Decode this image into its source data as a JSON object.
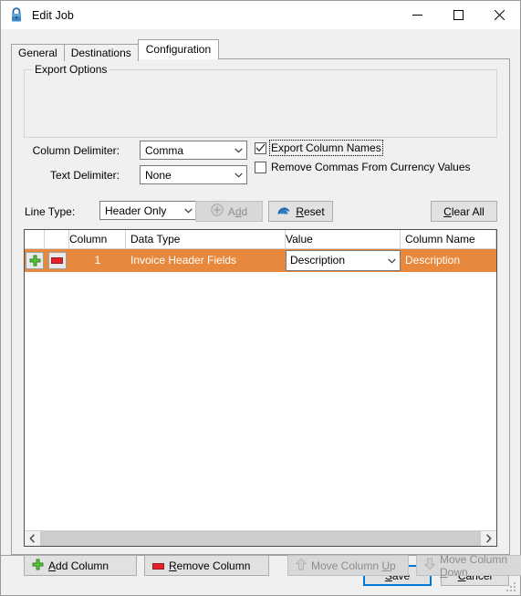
{
  "window": {
    "title": "Edit Job",
    "icon": "lock-icon",
    "controls": {
      "minimize": "—",
      "maximize": "☐",
      "close": "✕"
    }
  },
  "tabs": [
    {
      "label": "General",
      "active": false
    },
    {
      "label": "Destinations",
      "active": false
    },
    {
      "label": "Configuration",
      "active": true
    }
  ],
  "export_options": {
    "group_label": "Export Options",
    "column_delimiter": {
      "label": "Column Delimiter:",
      "value": "Comma"
    },
    "text_delimiter": {
      "label": "Text Delimiter:",
      "value": "None"
    },
    "export_column_names": {
      "label": "Export Column Names",
      "checked": true,
      "focused": true
    },
    "remove_commas": {
      "label": "Remove Commas From Currency Values",
      "checked": false
    }
  },
  "line_type": {
    "label": "Line Type:",
    "value": "Header Only"
  },
  "toolbar": {
    "add": {
      "label": "Add",
      "accel": "d",
      "enabled": false,
      "icon": "plus-circle-icon"
    },
    "reset": {
      "label": "Reset",
      "accel": "R",
      "enabled": true,
      "icon": "reset-arrow-icon"
    },
    "clear_all": {
      "label": "Clear All",
      "accel": "C",
      "enabled": true
    }
  },
  "grid": {
    "columns": [
      "",
      "",
      "Column",
      "Data Type",
      "Value",
      "Column Name"
    ],
    "rows": [
      {
        "selected": true,
        "add_icon": "green-plus-icon",
        "remove_icon": "red-minus-icon",
        "column": "1",
        "data_type": "Invoice Header Fields",
        "value": "Description",
        "column_name": "Description"
      }
    ],
    "scrollbar": {
      "left_arrow": "‹",
      "right_arrow": "›"
    }
  },
  "actions": {
    "add_column": {
      "label": "Add Column",
      "accel": "A",
      "enabled": true,
      "icon": "green-plus-icon"
    },
    "remove_column": {
      "label": "Remove Column",
      "accel": "R",
      "enabled": true,
      "icon": "red-minus-icon"
    },
    "move_up": {
      "label": "Move Column Up",
      "accel": "U",
      "enabled": false,
      "icon": "arrow-up-icon"
    },
    "move_down": {
      "label": "Move Column Down",
      "accel": "D",
      "enabled": false,
      "icon": "arrow-down-icon"
    }
  },
  "footer": {
    "save": {
      "label": "Save",
      "accel": "S",
      "default": true
    },
    "cancel": {
      "label": "Cancel",
      "accel": "C"
    }
  },
  "colors": {
    "selection": "#e8883c",
    "accent": "#0078d7",
    "dialog_bg": "#f0f0f0"
  }
}
